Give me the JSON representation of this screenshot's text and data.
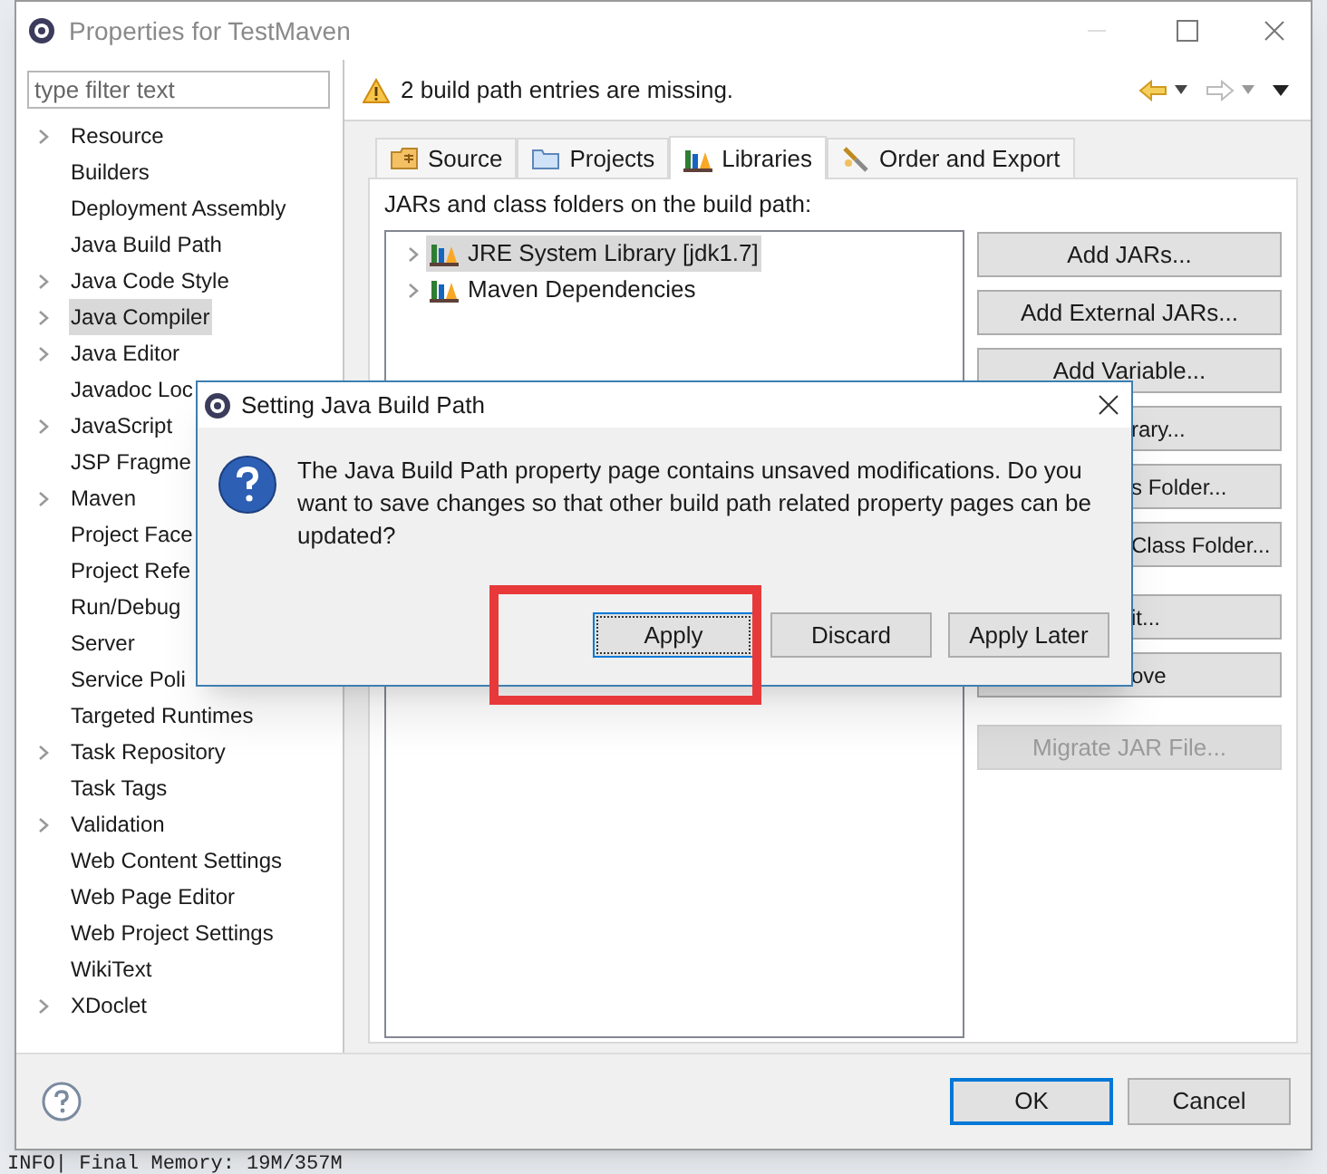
{
  "window": {
    "title": "Properties for TestMaven"
  },
  "filter": {
    "placeholder": "type filter text"
  },
  "sidebar": {
    "items": [
      {
        "label": "Resource",
        "expandable": true,
        "selected": false
      },
      {
        "label": "Builders",
        "expandable": false,
        "selected": false
      },
      {
        "label": "Deployment Assembly",
        "expandable": false,
        "selected": false
      },
      {
        "label": "Java Build Path",
        "expandable": false,
        "selected": false
      },
      {
        "label": "Java Code Style",
        "expandable": true,
        "selected": false
      },
      {
        "label": "Java Compiler",
        "expandable": true,
        "selected": true
      },
      {
        "label": "Java Editor",
        "expandable": true,
        "selected": false
      },
      {
        "label": "Javadoc Loc",
        "expandable": false,
        "selected": false
      },
      {
        "label": "JavaScript",
        "expandable": true,
        "selected": false
      },
      {
        "label": "JSP Fragme",
        "expandable": false,
        "selected": false
      },
      {
        "label": "Maven",
        "expandable": true,
        "selected": false
      },
      {
        "label": "Project Face",
        "expandable": false,
        "selected": false
      },
      {
        "label": "Project Refe",
        "expandable": false,
        "selected": false
      },
      {
        "label": "Run/Debug",
        "expandable": false,
        "selected": false
      },
      {
        "label": "Server",
        "expandable": false,
        "selected": false
      },
      {
        "label": "Service Poli",
        "expandable": false,
        "selected": false
      },
      {
        "label": "Targeted Runtimes",
        "expandable": false,
        "selected": false
      },
      {
        "label": "Task Repository",
        "expandable": true,
        "selected": false
      },
      {
        "label": "Task Tags",
        "expandable": false,
        "selected": false
      },
      {
        "label": "Validation",
        "expandable": true,
        "selected": false
      },
      {
        "label": "Web Content Settings",
        "expandable": false,
        "selected": false
      },
      {
        "label": "Web Page Editor",
        "expandable": false,
        "selected": false
      },
      {
        "label": "Web Project Settings",
        "expandable": false,
        "selected": false
      },
      {
        "label": "WikiText",
        "expandable": false,
        "selected": false
      },
      {
        "label": "XDoclet",
        "expandable": true,
        "selected": false
      }
    ]
  },
  "message": {
    "kind": "warning",
    "text": "2 build path entries are missing."
  },
  "tabs": [
    {
      "label": "Source",
      "kind": "source",
      "selected": false
    },
    {
      "label": "Projects",
      "kind": "projects",
      "selected": false
    },
    {
      "label": "Libraries",
      "kind": "libraries",
      "selected": true
    },
    {
      "label": "Order and Export",
      "kind": "order",
      "selected": false
    }
  ],
  "libraries": {
    "caption": "JARs and class folders on the build path:",
    "items": [
      {
        "label": "JRE System Library [jdk1.7]",
        "selected": true
      },
      {
        "label": "Maven Dependencies",
        "selected": false
      }
    ]
  },
  "button_groups": [
    [
      {
        "label": "Add JARs...",
        "disabled": false,
        "covered": false
      },
      {
        "label": "Add External JARs...",
        "disabled": false,
        "covered": false
      },
      {
        "label": "Add Variable...",
        "disabled": false,
        "covered": false
      },
      {
        "label": "rary...",
        "disabled": false,
        "covered": true
      },
      {
        "label": "s Folder...",
        "disabled": false,
        "covered": true
      },
      {
        "label": "Class Folder...",
        "disabled": false,
        "covered": true
      }
    ],
    [
      {
        "label": "it...",
        "disabled": false,
        "covered": true
      },
      {
        "label": "ove",
        "disabled": false,
        "covered": true
      }
    ],
    [
      {
        "label": "Migrate JAR File...",
        "disabled": true,
        "covered": false
      }
    ]
  ],
  "footer": {
    "buttons": [
      {
        "label": "OK",
        "default": true
      },
      {
        "label": "Cancel",
        "default": false
      }
    ]
  },
  "dialog": {
    "title": "Setting Java Build Path",
    "message": "The Java Build Path property page contains unsaved modifications. Do you want to save changes so that other build path related property pages can be updated?",
    "buttons": [
      {
        "label": "Apply",
        "default": true
      },
      {
        "label": "Discard",
        "default": false
      },
      {
        "label": "Apply Later",
        "default": false
      }
    ]
  },
  "console": {
    "line": "INFO| Final Memory: 19M/357M"
  }
}
